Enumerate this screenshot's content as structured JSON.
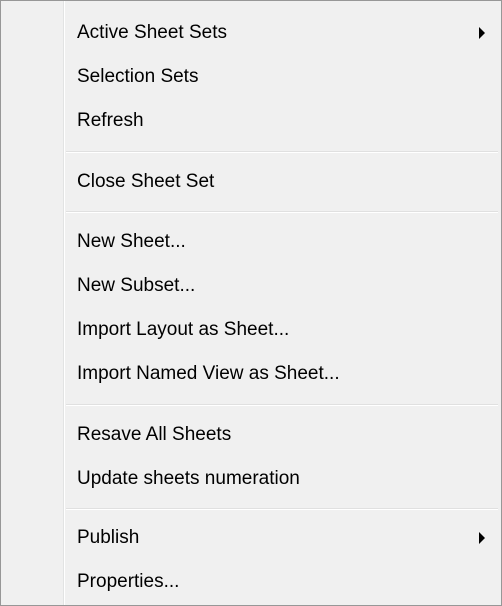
{
  "menu": {
    "groups": [
      {
        "items": [
          {
            "label": "Active Sheet Sets",
            "submenu": true
          },
          {
            "label": "Selection Sets",
            "submenu": false
          },
          {
            "label": "Refresh",
            "submenu": false
          }
        ]
      },
      {
        "items": [
          {
            "label": "Close Sheet Set",
            "submenu": false
          }
        ]
      },
      {
        "items": [
          {
            "label": "New Sheet...",
            "submenu": false
          },
          {
            "label": "New Subset...",
            "submenu": false
          },
          {
            "label": "Import Layout as Sheet...",
            "submenu": false
          },
          {
            "label": "Import Named View as Sheet...",
            "submenu": false
          }
        ]
      },
      {
        "items": [
          {
            "label": "Resave All Sheets",
            "submenu": false
          },
          {
            "label": "Update sheets numeration",
            "submenu": false
          }
        ]
      },
      {
        "items": [
          {
            "label": "Publish",
            "submenu": true
          },
          {
            "label": "Properties...",
            "submenu": false
          }
        ]
      }
    ]
  }
}
